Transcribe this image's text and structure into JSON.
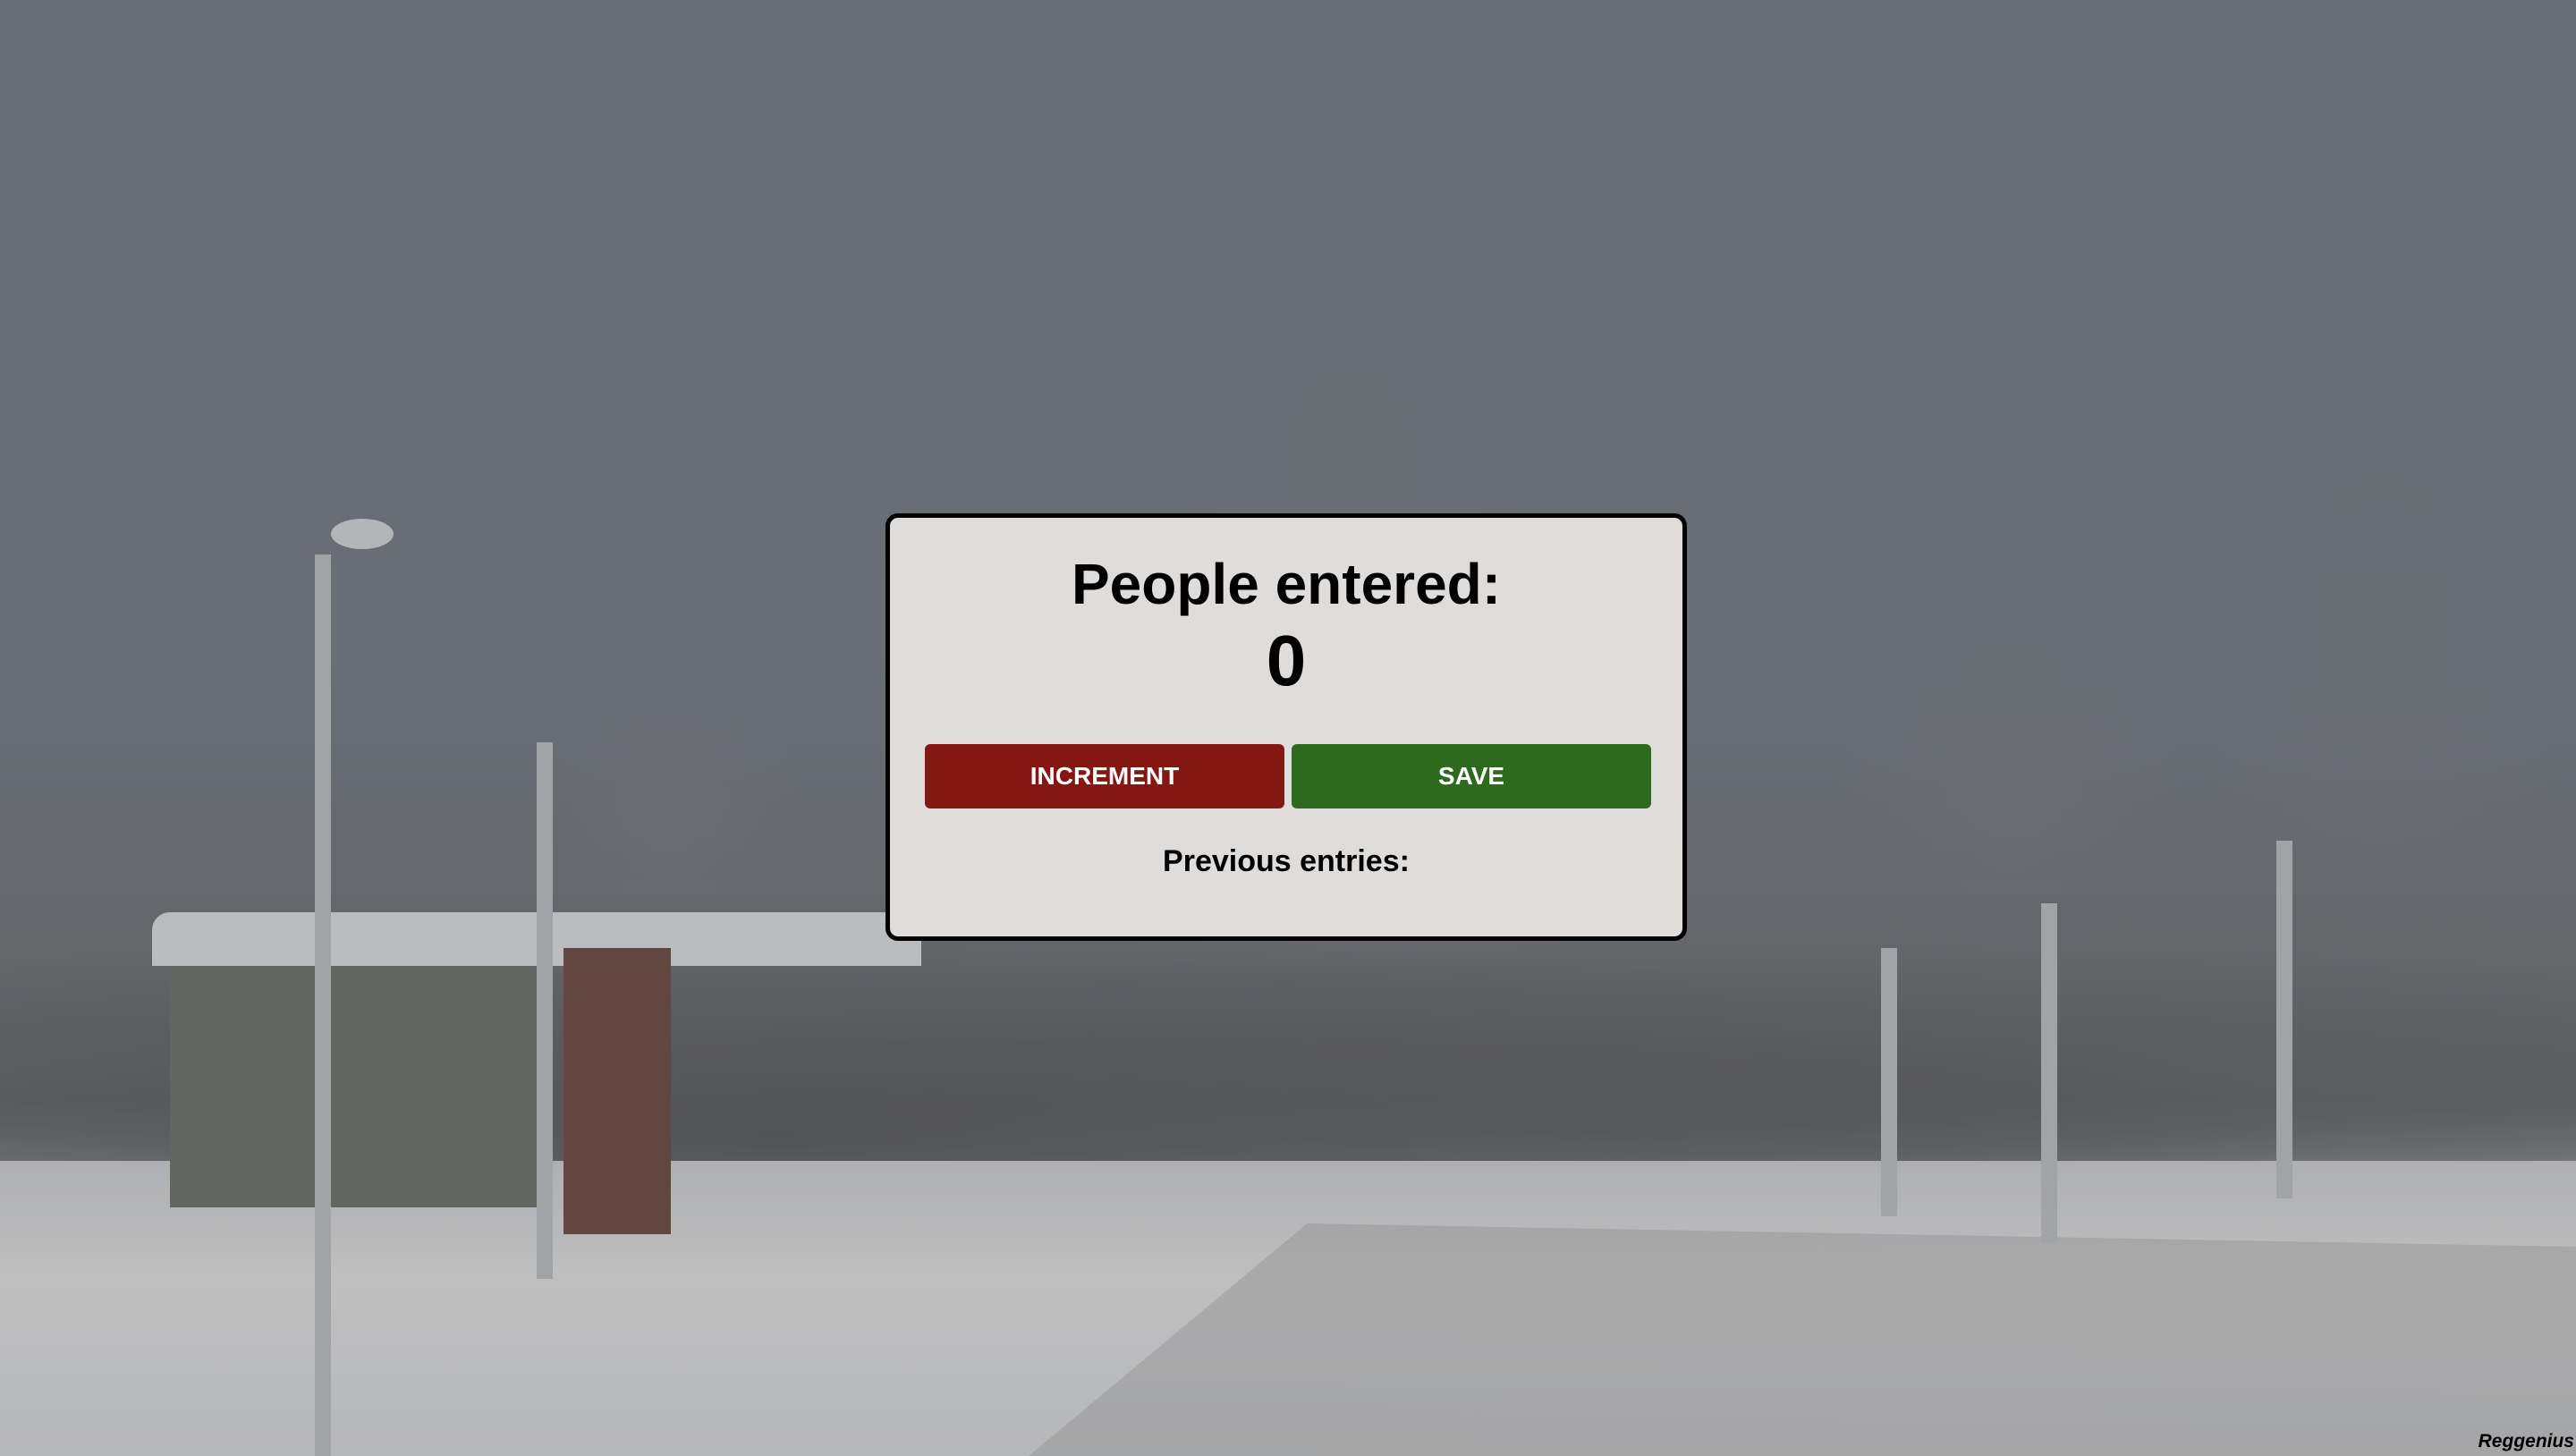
{
  "modal": {
    "title": "People entered:",
    "count": "0",
    "increment_label": "INCREMENT",
    "save_label": "SAVE",
    "previous_entries_label": "Previous entries:"
  },
  "credit": "Reggenius",
  "colors": {
    "increment": "#861612",
    "save": "#2d6a1e",
    "modal_bg": "#dedddc"
  }
}
